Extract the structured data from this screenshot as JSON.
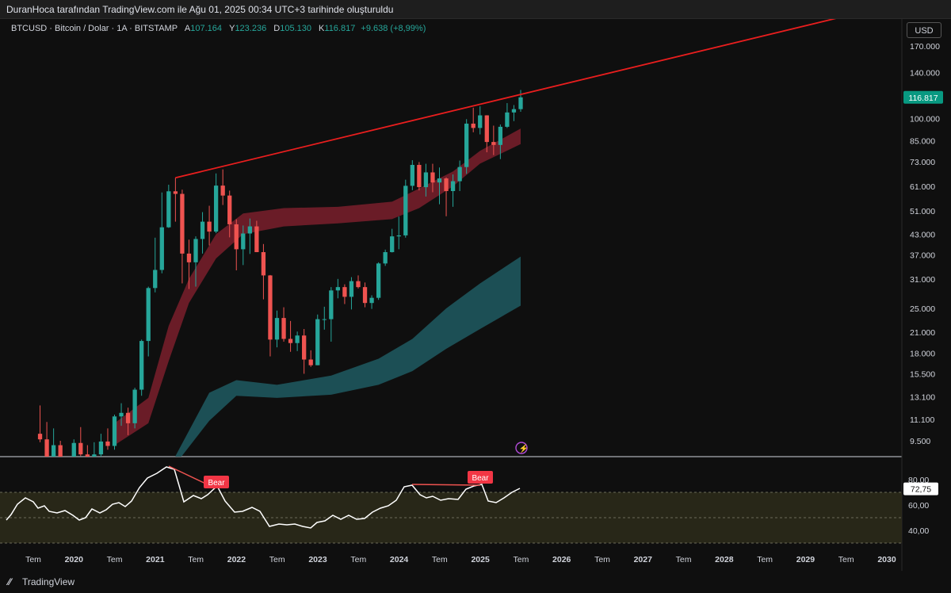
{
  "header": {
    "caption": "DuranHoca tarafından TradingView.com ile Ağu 01, 2025 00:34 UTC+3 tarihinde oluşturuldu"
  },
  "legend": {
    "symbol": "BTCUSD · Bitcoin / Dolar · 1A · BITSTAMP",
    "open_label": "A",
    "open": "107.164",
    "high_label": "Y",
    "high": "123.236",
    "low_label": "D",
    "low": "105.130",
    "close_label": "K",
    "close": "116.817",
    "change": "+9.638 (+8,99%)"
  },
  "currency": "USD",
  "price_axis": {
    "ticks": [
      "170.000",
      "140.000",
      "100.000",
      "85.000",
      "73.000",
      "61.000",
      "51.000",
      "43.000",
      "37.000",
      "31.000",
      "25.000",
      "21.000",
      "18.000",
      "15.500",
      "13.100",
      "11.100",
      "9.500"
    ],
    "current_price_label": "116.817"
  },
  "rsi_axis": {
    "ticks": [
      "80,00",
      "60,00",
      "40,00"
    ],
    "current_label": "72,75"
  },
  "time_axis": {
    "labels": [
      {
        "text": "Tem",
        "bold": false
      },
      {
        "text": "2020",
        "bold": true
      },
      {
        "text": "Tem",
        "bold": false
      },
      {
        "text": "2021",
        "bold": true
      },
      {
        "text": "Tem",
        "bold": false
      },
      {
        "text": "2022",
        "bold": true
      },
      {
        "text": "Tem",
        "bold": false
      },
      {
        "text": "2023",
        "bold": true
      },
      {
        "text": "Tem",
        "bold": false
      },
      {
        "text": "2024",
        "bold": true
      },
      {
        "text": "Tem",
        "bold": false
      },
      {
        "text": "2025",
        "bold": true
      },
      {
        "text": "Tem",
        "bold": false
      },
      {
        "text": "2026",
        "bold": true
      },
      {
        "text": "Tem",
        "bold": false
      },
      {
        "text": "2027",
        "bold": true
      },
      {
        "text": "Tem",
        "bold": false
      },
      {
        "text": "2028",
        "bold": true
      },
      {
        "text": "Tem",
        "bold": false
      },
      {
        "text": "2029",
        "bold": true
      },
      {
        "text": "Tem",
        "bold": false
      },
      {
        "text": "2030",
        "bold": true
      }
    ]
  },
  "annotations": {
    "bear_label_1": "Bear",
    "bear_label_2": "Bear"
  },
  "colors": {
    "up": "#26a69a",
    "down": "#ef5350",
    "trendline": "#e91e1e",
    "red_band": "#7a1f2b",
    "teal_band": "#1e5a62",
    "rsi_fill": "#2b2a1a"
  },
  "footer": {
    "brand": "TradingView"
  },
  "chart_data": [
    {
      "type": "candlestick",
      "title": "BTCUSD · Bitcoin / Dolar · 1A · BITSTAMP",
      "scale": "log",
      "ylim": [
        9000,
        200000
      ],
      "xlim": [
        "2019-07",
        "2030-04"
      ],
      "ohlc_last": {
        "open": 107164,
        "high": 123236,
        "low": 105130,
        "close": 116817
      },
      "series": [
        {
          "name": "monthly",
          "points": [
            {
              "t": "2021-01",
              "o": 29000,
              "h": 41900,
              "l": 28100,
              "c": 33100
            },
            {
              "t": "2021-02",
              "o": 33100,
              "h": 58300,
              "l": 32300,
              "c": 45200
            },
            {
              "t": "2021-03",
              "o": 45200,
              "h": 61700,
              "l": 45000,
              "c": 58800
            },
            {
              "t": "2021-04",
              "o": 58800,
              "h": 64900,
              "l": 47100,
              "c": 57700
            },
            {
              "t": "2021-05",
              "o": 57700,
              "h": 59500,
              "l": 30000,
              "c": 37300
            },
            {
              "t": "2021-06",
              "o": 37300,
              "h": 41300,
              "l": 28800,
              "c": 35000
            },
            {
              "t": "2021-07",
              "o": 35000,
              "h": 42300,
              "l": 29300,
              "c": 41500
            },
            {
              "t": "2021-08",
              "o": 41500,
              "h": 50500,
              "l": 37300,
              "c": 47100
            },
            {
              "t": "2021-09",
              "o": 47100,
              "h": 52900,
              "l": 39600,
              "c": 43800
            },
            {
              "t": "2021-10",
              "o": 43800,
              "h": 67000,
              "l": 43300,
              "c": 61300
            },
            {
              "t": "2021-11",
              "o": 61300,
              "h": 69000,
              "l": 53200,
              "c": 57000
            },
            {
              "t": "2021-12",
              "o": 57000,
              "h": 59100,
              "l": 42000,
              "c": 46200
            },
            {
              "t": "2022-01",
              "o": 46200,
              "h": 47900,
              "l": 33000,
              "c": 38500
            },
            {
              "t": "2022-02",
              "o": 38500,
              "h": 45800,
              "l": 34300,
              "c": 43200
            },
            {
              "t": "2022-03",
              "o": 43200,
              "h": 48200,
              "l": 37200,
              "c": 45500
            },
            {
              "t": "2022-04",
              "o": 45500,
              "h": 47400,
              "l": 37700,
              "c": 37700
            },
            {
              "t": "2022-05",
              "o": 37700,
              "h": 40000,
              "l": 26700,
              "c": 31800
            },
            {
              "t": "2022-06",
              "o": 31800,
              "h": 31900,
              "l": 17600,
              "c": 19900
            },
            {
              "t": "2022-07",
              "o": 19900,
              "h": 24600,
              "l": 18800,
              "c": 23300
            },
            {
              "t": "2022-08",
              "o": 23300,
              "h": 25200,
              "l": 19600,
              "c": 20000
            },
            {
              "t": "2022-09",
              "o": 20000,
              "h": 22800,
              "l": 18200,
              "c": 19400
            },
            {
              "t": "2022-10",
              "o": 19400,
              "h": 21100,
              "l": 18300,
              "c": 20500
            },
            {
              "t": "2022-11",
              "o": 20500,
              "h": 21500,
              "l": 15500,
              "c": 17200
            },
            {
              "t": "2022-12",
              "o": 17200,
              "h": 18400,
              "l": 16300,
              "c": 16500
            },
            {
              "t": "2023-01",
              "o": 16500,
              "h": 23900,
              "l": 16500,
              "c": 23100
            },
            {
              "t": "2023-02",
              "o": 23100,
              "h": 25300,
              "l": 21400,
              "c": 23100
            },
            {
              "t": "2023-03",
              "o": 23100,
              "h": 29200,
              "l": 19600,
              "c": 28500
            },
            {
              "t": "2023-04",
              "o": 28500,
              "h": 31000,
              "l": 26900,
              "c": 29200
            },
            {
              "t": "2023-05",
              "o": 29200,
              "h": 29800,
              "l": 25800,
              "c": 27200
            },
            {
              "t": "2023-06",
              "o": 27200,
              "h": 31400,
              "l": 24800,
              "c": 30500
            },
            {
              "t": "2023-07",
              "o": 30500,
              "h": 31800,
              "l": 28900,
              "c": 29200
            },
            {
              "t": "2023-08",
              "o": 29200,
              "h": 30200,
              "l": 25200,
              "c": 26000
            },
            {
              "t": "2023-09",
              "o": 26000,
              "h": 27500,
              "l": 24900,
              "c": 27000
            },
            {
              "t": "2023-10",
              "o": 27000,
              "h": 35000,
              "l": 26600,
              "c": 34700
            },
            {
              "t": "2023-11",
              "o": 34700,
              "h": 38400,
              "l": 34100,
              "c": 37700
            },
            {
              "t": "2023-12",
              "o": 37700,
              "h": 44700,
              "l": 37600,
              "c": 42300
            },
            {
              "t": "2024-01",
              "o": 42300,
              "h": 48900,
              "l": 38500,
              "c": 42600
            },
            {
              "t": "2024-02",
              "o": 42600,
              "h": 64000,
              "l": 41900,
              "c": 61200
            },
            {
              "t": "2024-03",
              "o": 61200,
              "h": 73800,
              "l": 59300,
              "c": 71300
            },
            {
              "t": "2024-04",
              "o": 71300,
              "h": 72800,
              "l": 59200,
              "c": 60600
            },
            {
              "t": "2024-05",
              "o": 60600,
              "h": 71900,
              "l": 56600,
              "c": 67500
            },
            {
              "t": "2024-06",
              "o": 67500,
              "h": 71900,
              "l": 58400,
              "c": 62700
            },
            {
              "t": "2024-07",
              "o": 62700,
              "h": 70000,
              "l": 53500,
              "c": 64600
            },
            {
              "t": "2024-08",
              "o": 64600,
              "h": 65100,
              "l": 49000,
              "c": 58900
            },
            {
              "t": "2024-09",
              "o": 58900,
              "h": 66500,
              "l": 52500,
              "c": 63300
            },
            {
              "t": "2024-10",
              "o": 63300,
              "h": 73600,
              "l": 58900,
              "c": 70200
            },
            {
              "t": "2024-11",
              "o": 70200,
              "h": 99600,
              "l": 66800,
              "c": 96400
            },
            {
              "t": "2024-12",
              "o": 96400,
              "h": 108300,
              "l": 90500,
              "c": 93400
            },
            {
              "t": "2025-01",
              "o": 93400,
              "h": 109400,
              "l": 89100,
              "c": 102400
            },
            {
              "t": "2025-02",
              "o": 102400,
              "h": 102500,
              "l": 78200,
              "c": 84300
            },
            {
              "t": "2025-03",
              "o": 84300,
              "h": 95000,
              "l": 76600,
              "c": 82500
            },
            {
              "t": "2025-04",
              "o": 82500,
              "h": 95800,
              "l": 74400,
              "c": 94200
            },
            {
              "t": "2025-05",
              "o": 94200,
              "h": 112000,
              "l": 93400,
              "c": 104600
            },
            {
              "t": "2025-06",
              "o": 104600,
              "h": 110400,
              "l": 98200,
              "c": 107164
            },
            {
              "t": "2025-07",
              "o": 107164,
              "h": 123236,
              "l": 105130,
              "c": 116817
            }
          ]
        }
      ]
    },
    {
      "type": "line",
      "title": "",
      "ylim": [
        30,
        90
      ],
      "current": 72.75,
      "series": [
        {
          "name": "",
          "points": [
            {
              "t": "2021-01",
              "v": 82
            },
            {
              "t": "2021-03",
              "v": 90
            },
            {
              "t": "2021-04",
              "v": 88
            },
            {
              "t": "2021-05",
              "v": 62
            },
            {
              "t": "2021-07",
              "v": 65
            },
            {
              "t": "2021-10",
              "v": 71
            },
            {
              "t": "2021-12",
              "v": 63
            },
            {
              "t": "2022-02",
              "v": 58
            },
            {
              "t": "2022-06",
              "v": 42
            },
            {
              "t": "2022-12",
              "v": 38
            },
            {
              "t": "2023-03",
              "v": 45
            },
            {
              "t": "2023-06",
              "v": 47
            },
            {
              "t": "2023-09",
              "v": 45
            },
            {
              "t": "2023-12",
              "v": 60
            },
            {
              "t": "2024-03",
              "v": 76
            },
            {
              "t": "2024-08",
              "v": 67
            },
            {
              "t": "2024-12",
              "v": 77
            },
            {
              "t": "2025-02",
              "v": 63
            },
            {
              "t": "2025-07",
              "v": 72.75
            }
          ]
        }
      ]
    }
  ]
}
